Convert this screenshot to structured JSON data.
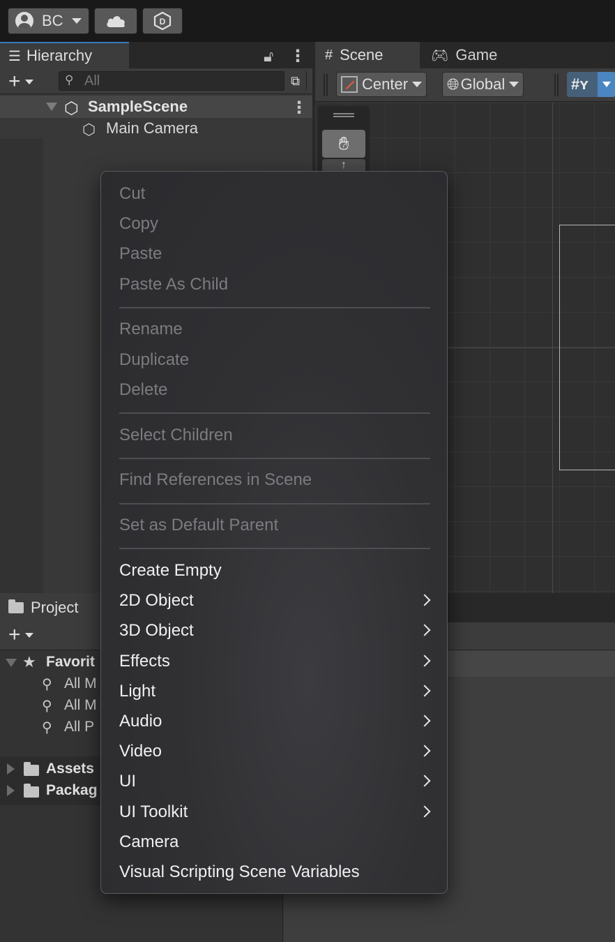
{
  "topbar": {
    "account_label": "BC",
    "cloud_icon": "cloud-icon",
    "plastic_icon": "plastic-scm-icon"
  },
  "hierarchy": {
    "tab_label": "Hierarchy",
    "search_placeholder": "All",
    "scene_name": "SampleScene",
    "objects": [
      "Main Camera"
    ]
  },
  "scene": {
    "tabs": [
      "Scene",
      "Game"
    ],
    "pivot_label": "Center",
    "space_label": "Global"
  },
  "project": {
    "tab_label": "Project",
    "favorites_label": "Favorit",
    "favorite_items": [
      "All M",
      "All M",
      "All P"
    ],
    "folders": [
      "Assets",
      "Packag"
    ]
  },
  "context_menu": {
    "groups": [
      [
        {
          "label": "Cut",
          "enabled": false,
          "submenu": false
        },
        {
          "label": "Copy",
          "enabled": false,
          "submenu": false
        },
        {
          "label": "Paste",
          "enabled": false,
          "submenu": false
        },
        {
          "label": "Paste As Child",
          "enabled": false,
          "submenu": false
        }
      ],
      [
        {
          "label": "Rename",
          "enabled": false,
          "submenu": false
        },
        {
          "label": "Duplicate",
          "enabled": false,
          "submenu": false
        },
        {
          "label": "Delete",
          "enabled": false,
          "submenu": false
        }
      ],
      [
        {
          "label": "Select Children",
          "enabled": false,
          "submenu": false
        }
      ],
      [
        {
          "label": "Find References in Scene",
          "enabled": false,
          "submenu": false
        }
      ],
      [
        {
          "label": "Set as Default Parent",
          "enabled": false,
          "submenu": false
        }
      ],
      [
        {
          "label": "Create Empty",
          "enabled": true,
          "submenu": false
        },
        {
          "label": "2D Object",
          "enabled": true,
          "submenu": true
        },
        {
          "label": "3D Object",
          "enabled": true,
          "submenu": true
        },
        {
          "label": "Effects",
          "enabled": true,
          "submenu": true
        },
        {
          "label": "Light",
          "enabled": true,
          "submenu": true
        },
        {
          "label": "Audio",
          "enabled": true,
          "submenu": true
        },
        {
          "label": "Video",
          "enabled": true,
          "submenu": true
        },
        {
          "label": "UI",
          "enabled": true,
          "submenu": true
        },
        {
          "label": "UI Toolkit",
          "enabled": true,
          "submenu": true
        },
        {
          "label": "Camera",
          "enabled": true,
          "submenu": false
        },
        {
          "label": "Visual Scripting Scene Variables",
          "enabled": true,
          "submenu": false
        }
      ]
    ]
  }
}
